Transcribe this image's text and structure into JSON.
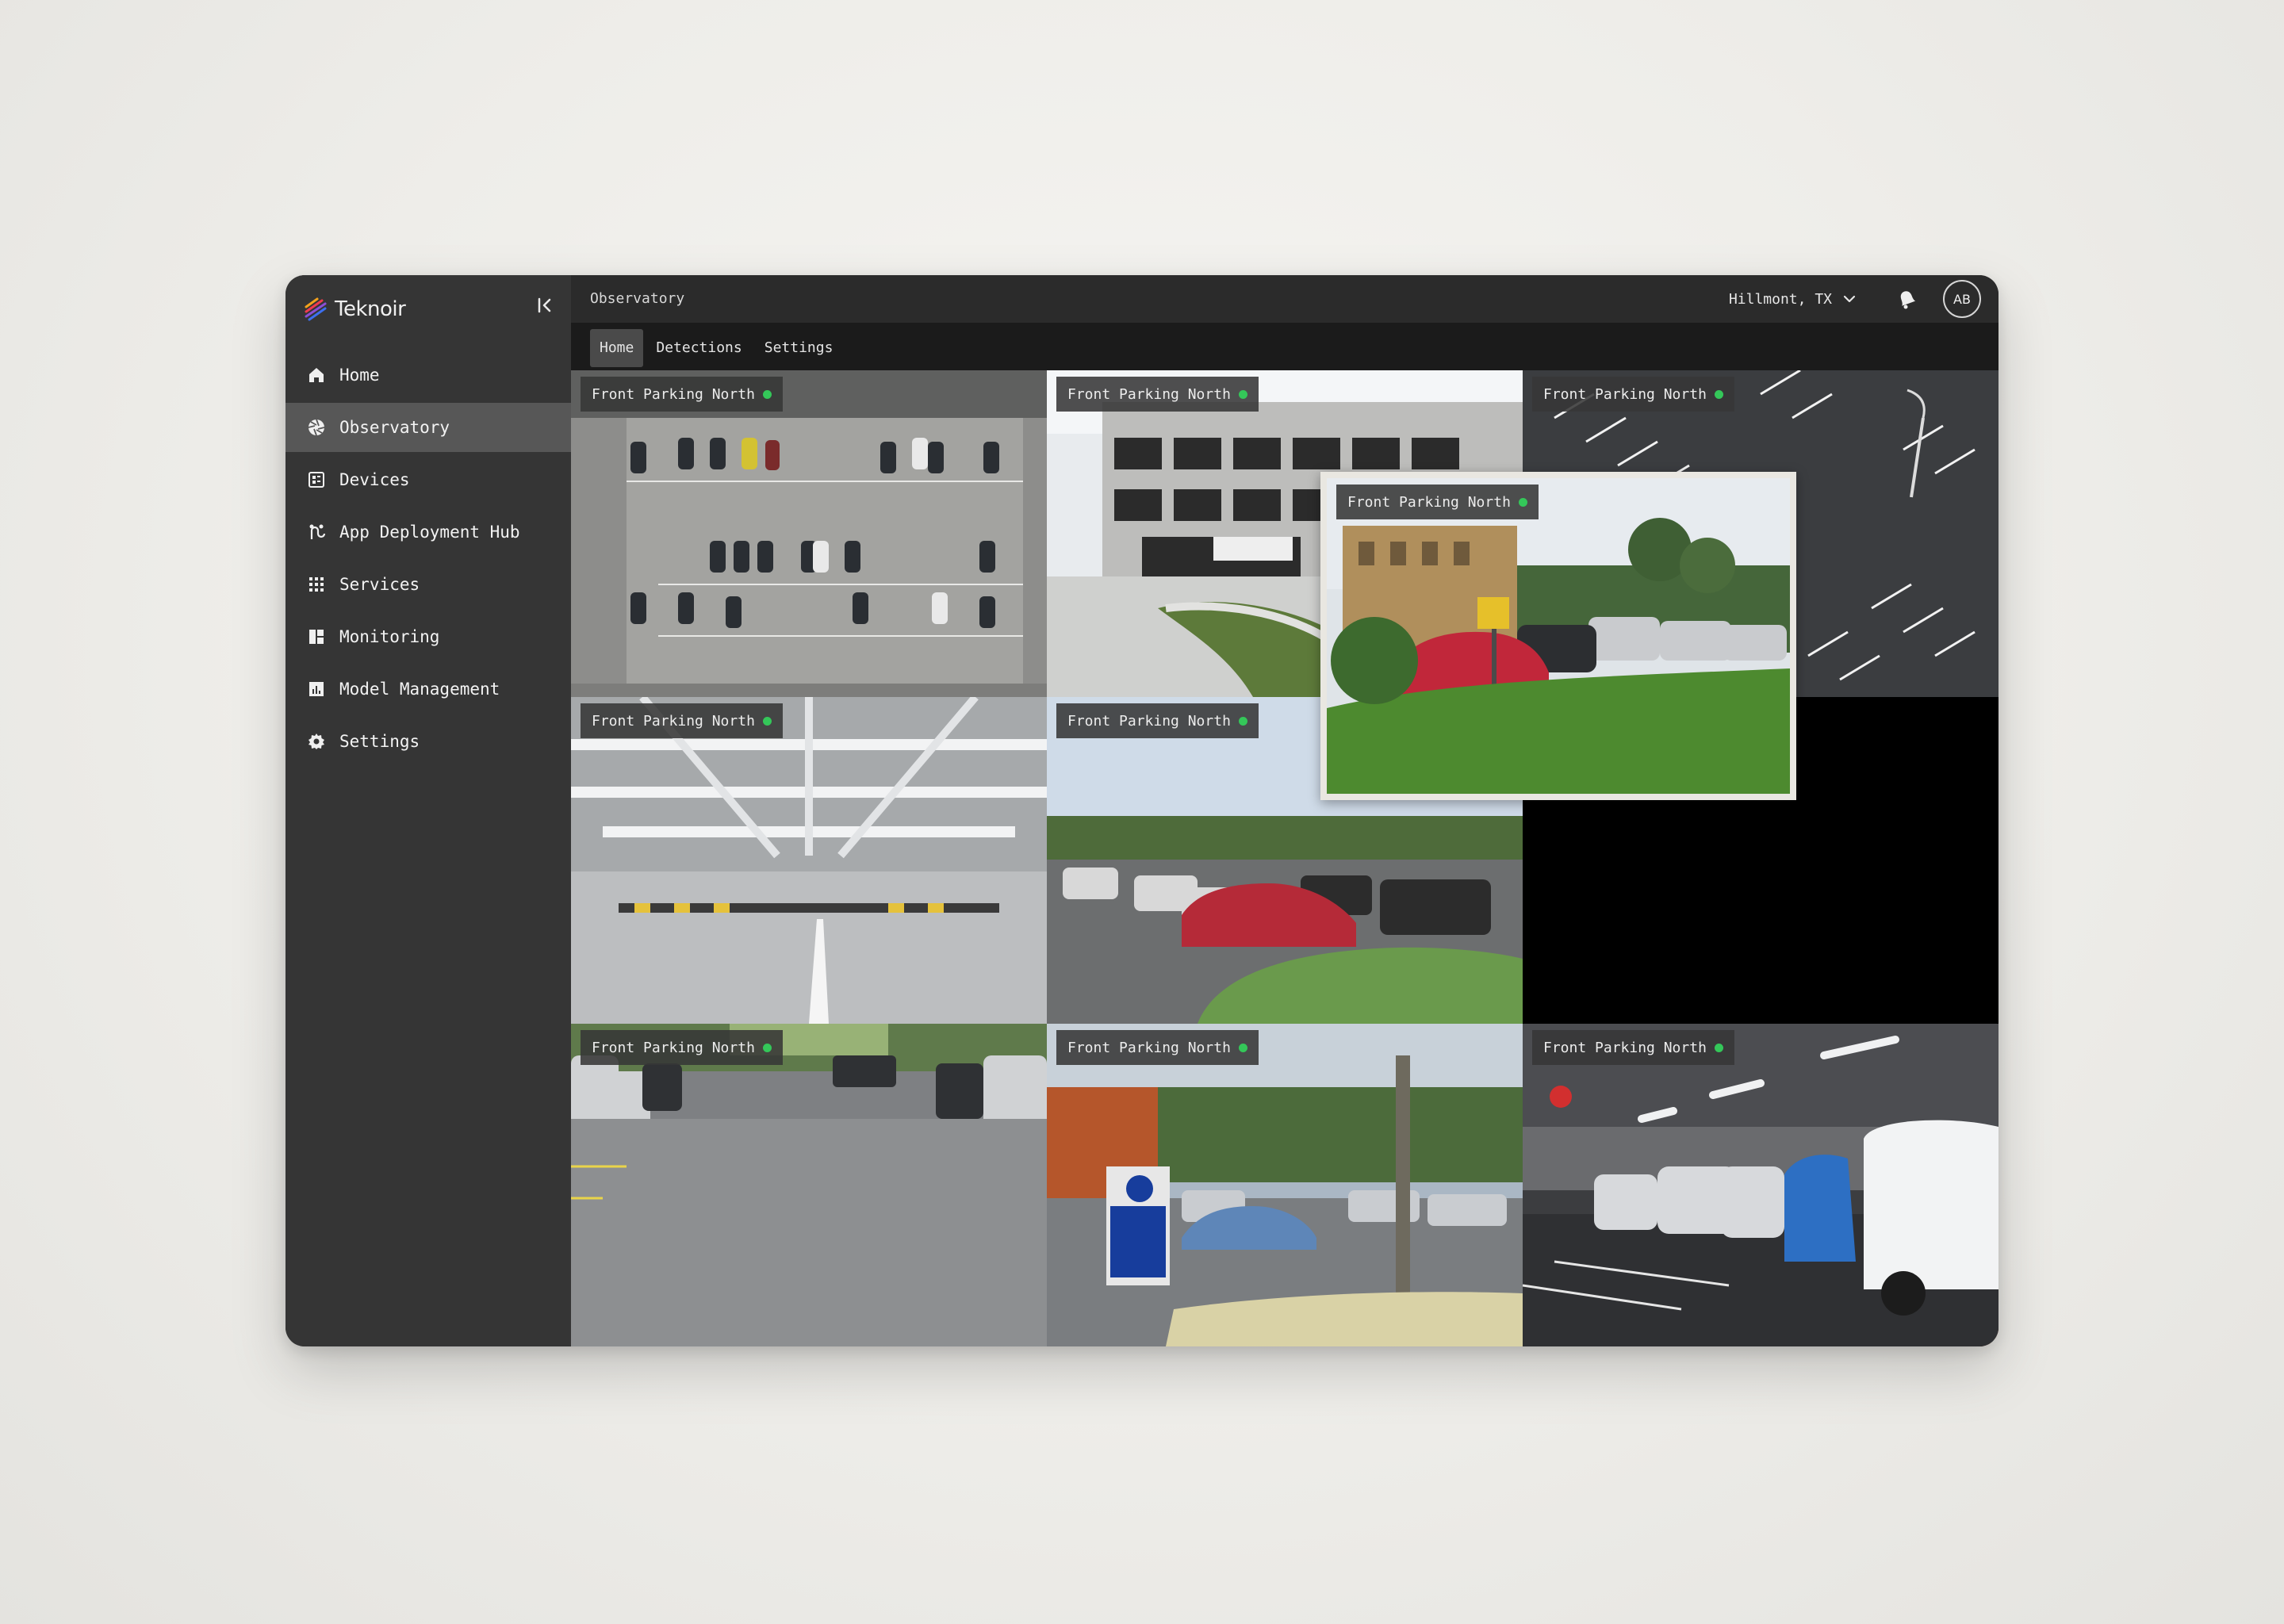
{
  "app": {
    "brand": "Teknoir",
    "breadcrumb": "Observatory"
  },
  "sidebar": {
    "items": [
      {
        "label": "Home",
        "icon": "home-icon"
      },
      {
        "label": "Observatory",
        "icon": "aperture-icon",
        "active": true
      },
      {
        "label": "Devices",
        "icon": "devices-icon"
      },
      {
        "label": "App Deployment Hub",
        "icon": "deployment-icon"
      },
      {
        "label": "Services",
        "icon": "grid-icon"
      },
      {
        "label": "Monitoring",
        "icon": "dashboard-icon"
      },
      {
        "label": "Model Management",
        "icon": "chart-icon"
      },
      {
        "label": "Settings",
        "icon": "gear-icon"
      }
    ]
  },
  "header": {
    "location": "Hillmont, TX",
    "avatar_initials": "AB"
  },
  "tabs": [
    {
      "label": "Home",
      "active": true
    },
    {
      "label": "Detections"
    },
    {
      "label": "Settings"
    }
  ],
  "cameras": [
    {
      "label": "Front Parking North",
      "status": "online",
      "scene": "aerial lot"
    },
    {
      "label": "Front Parking North",
      "status": "online",
      "scene": "parking garage exterior"
    },
    {
      "label": "Front Parking North",
      "status": "online",
      "scene": "empty lot lines"
    },
    {
      "label": "Front Parking North",
      "status": "online",
      "scene": "covered garage interior"
    },
    {
      "label": "Front Parking North",
      "status": "online",
      "scene": "lot with red car"
    },
    {
      "label": "Front Parking North",
      "status": "online",
      "scene": "lot street view"
    },
    {
      "label": "Front Parking North",
      "status": "online",
      "scene": "permit parking lot"
    },
    {
      "label": "Front Parking North",
      "status": "online",
      "scene": "garage interior",
      "selected": true
    }
  ],
  "pip_camera": {
    "label": "Front Parking North",
    "status": "online",
    "scene": "cars by grass"
  },
  "colors": {
    "accent_selected": "#ff6a2b",
    "status_online": "#34c759",
    "sidebar_bg": "#353535",
    "sidebar_active": "#575757"
  }
}
